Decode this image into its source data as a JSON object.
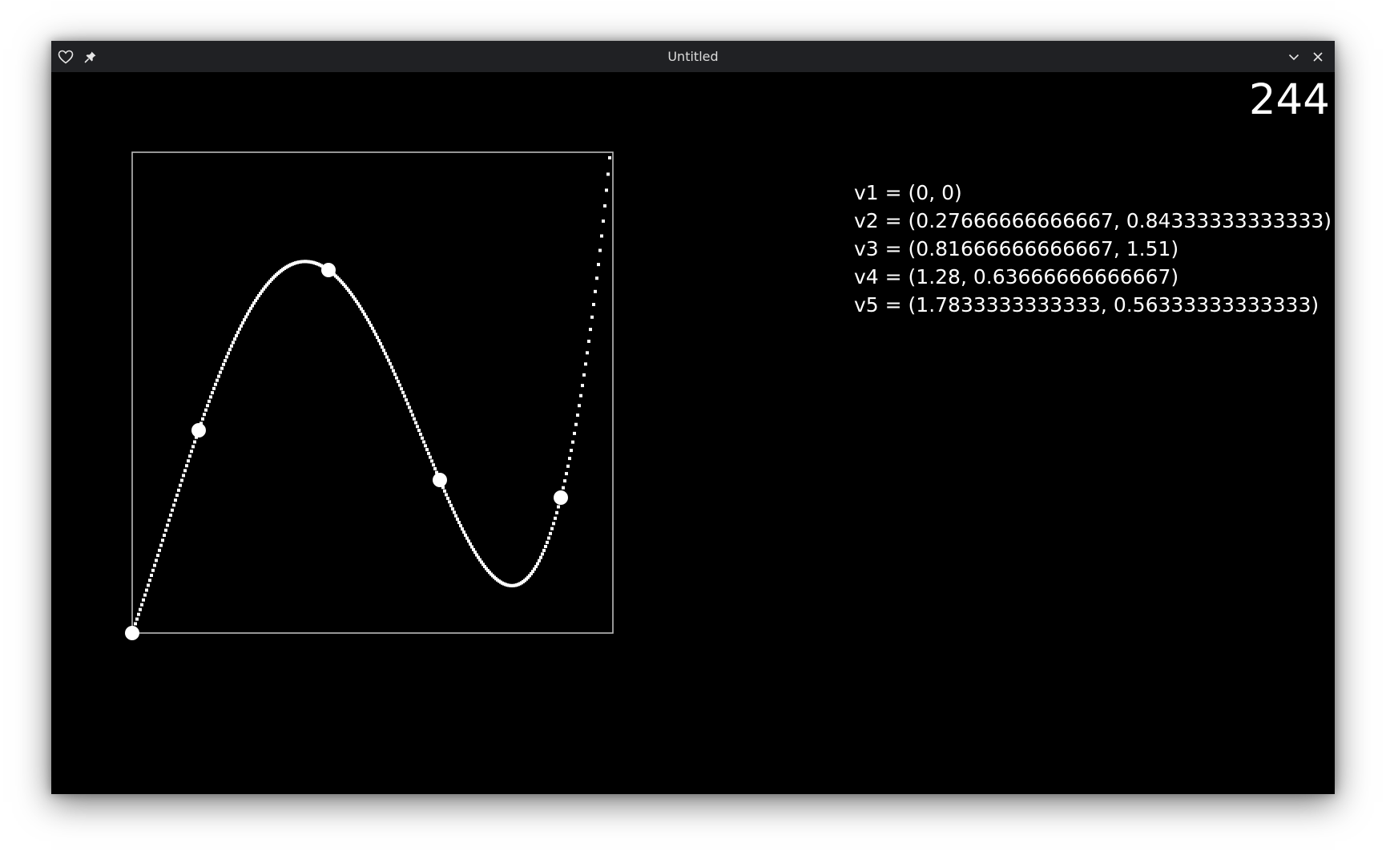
{
  "window": {
    "title": "Untitled",
    "icons": {
      "favorite": "heart-icon",
      "pin": "pin-icon",
      "minimize": "chevron-down-icon",
      "close": "close-icon"
    }
  },
  "counter": "244",
  "vectors": [
    "v1 = (0, 0)",
    "v2 = (0.27666666666667, 0.84333333333333)",
    "v3 = (0.81666666666667, 1.51)",
    "v4 = (1.28, 0.63666666666667)",
    "v5 = (1.7833333333333, 0.56333333333333)"
  ],
  "chart_data": {
    "type": "scatter",
    "xlim": [
      0,
      2
    ],
    "ylim": [
      0,
      2
    ],
    "control_points": [
      {
        "x": 0,
        "y": 0
      },
      {
        "x": 0.27666666666667,
        "y": 0.84333333333333
      },
      {
        "x": 0.81666666666667,
        "y": 1.51
      },
      {
        "x": 1.28,
        "y": 0.63666666666667
      },
      {
        "x": 1.7833333333333,
        "y": 0.56333333333333
      }
    ],
    "curve": "interpolating polynomial through control points",
    "colors": {
      "background": "#000000",
      "curve": "#ffffff",
      "frame": "#bbbbbb"
    }
  }
}
